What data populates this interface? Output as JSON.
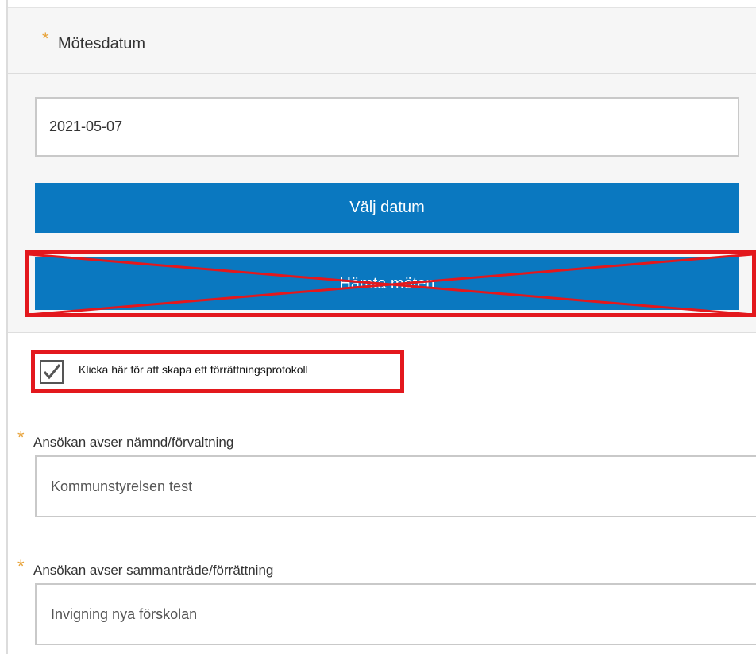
{
  "meeting_date": {
    "required_mark": "*",
    "label": "Mötesdatum",
    "value": "2021-05-07"
  },
  "buttons": {
    "choose_date": "Välj datum",
    "fetch_meetings": "Hämta möten"
  },
  "protocol_checkbox": {
    "checked": true,
    "label": "Klicka här för att skapa ett förrättningsprotokoll"
  },
  "committee": {
    "required_mark": "*",
    "label": "Ansökan avser nämnd/förvaltning",
    "value": "Kommunstyrelsen test"
  },
  "session": {
    "required_mark": "*",
    "label": "Ansökan avser sammanträde/förrättning",
    "value": "Invigning nya förskolan"
  },
  "colors": {
    "accent_blue": "#0a78c0",
    "required_orange": "#e8a33a",
    "annotation_red": "#e3181d"
  },
  "icons": [
    "checkmark-icon",
    "red-cross-annotation"
  ]
}
